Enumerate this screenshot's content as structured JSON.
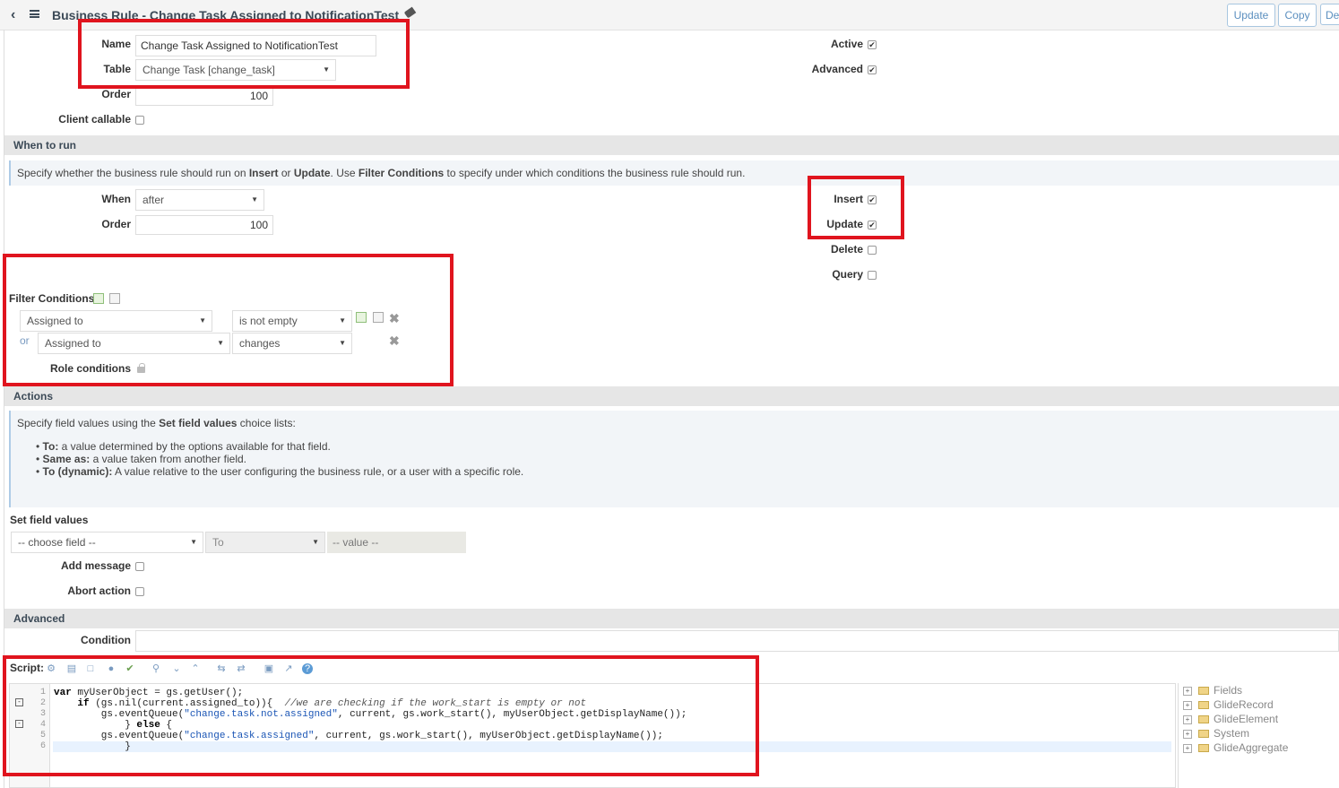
{
  "header": {
    "title": "Business Rule - Change Task Assigned to NotificationTest",
    "buttons": [
      "Update",
      "Copy",
      "De"
    ]
  },
  "form": {
    "name_label": "Name",
    "name_value": "Change Task Assigned to NotificationTest",
    "table_label": "Table",
    "table_value": "Change Task [change_task]",
    "order_label": "Order",
    "order_value": "100",
    "client_callable_label": "Client callable",
    "active_label": "Active",
    "advanced_label": "Advanced"
  },
  "when_to_run": {
    "section_title": "When to run",
    "info_parts": [
      "Specify whether the business rule should run on ",
      "Insert",
      " or ",
      "Update",
      ". Use ",
      "Filter Conditions",
      " to specify under which conditions the business rule should run."
    ],
    "when_label": "When",
    "when_value": "after",
    "order_label": "Order",
    "order_value": "100",
    "insert_label": "Insert",
    "update_label": "Update",
    "delete_label": "Delete",
    "query_label": "Query"
  },
  "filter": {
    "label": "Filter Conditions",
    "rows": [
      {
        "prefix": "",
        "field": "Assigned to",
        "operator": "is not empty"
      },
      {
        "prefix": "or",
        "field": "Assigned to",
        "operator": "changes"
      }
    ],
    "role_conditions_label": "Role conditions"
  },
  "actions": {
    "section_title": "Actions",
    "info_intro_parts": [
      "Specify field values using the ",
      "Set field values",
      " choice lists:"
    ],
    "bullets": [
      {
        "term": "To:",
        "text": " a value determined by the options available for that field."
      },
      {
        "term": "Same as:",
        "text": " a value taken from another field."
      },
      {
        "term": "To (dynamic):",
        "text": " A value relative to the user configuring the business rule, or a user with a specific role."
      }
    ],
    "set_field_values_label": "Set field values",
    "choose_field": "-- choose field --",
    "to_value": "To",
    "value_placeholder": "-- value --",
    "add_message_label": "Add message",
    "abort_action_label": "Abort action"
  },
  "advanced": {
    "section_title": "Advanced",
    "condition_label": "Condition",
    "script_label": "Script:",
    "line_numbers": [
      "1",
      "2",
      "3",
      "4",
      "5",
      "6"
    ],
    "tree": [
      "Fields",
      "GlideRecord",
      "GlideElement",
      "System",
      "GlideAggregate"
    ]
  },
  "colors": {
    "highlight_box": "#e0141e",
    "section_bg": "#e6e6e6",
    "info_bg": "#f2f5f8",
    "button_text": "#5b8fbf",
    "string_color": "#1a55b5"
  }
}
